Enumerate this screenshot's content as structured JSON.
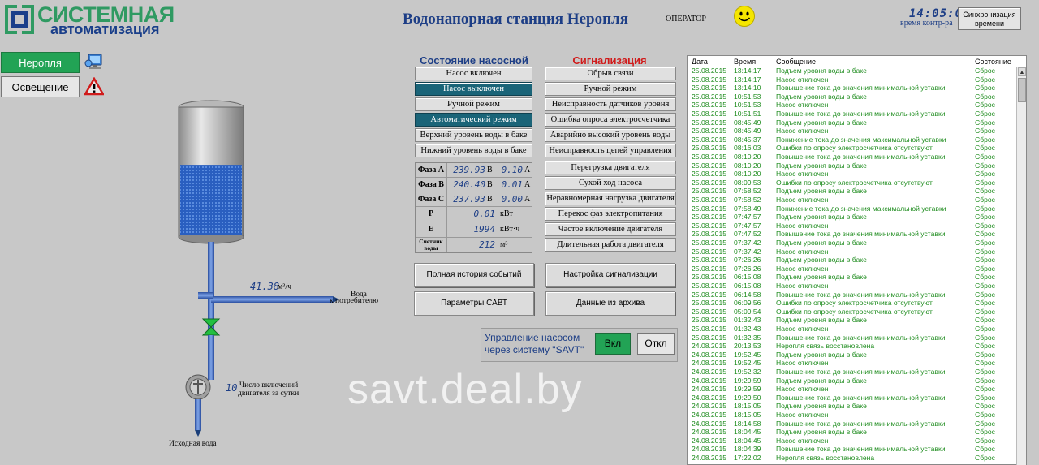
{
  "header": {
    "logo_line1": "СИСТЕМНАЯ",
    "logo_line2": "автоматизация",
    "title": "Водонапорная станция Неропля",
    "operator": "ОПЕРАТОР",
    "clock": "14:05:03",
    "clock_label": "время контр-ра",
    "sync_button": [
      "Синхронизация",
      "времени"
    ]
  },
  "nav": {
    "items": [
      {
        "label": "Неропля",
        "active": true
      },
      {
        "label": "Освещение",
        "active": false
      }
    ]
  },
  "diagram": {
    "flow_value": "41.38",
    "flow_unit": "м³/ч",
    "water_out": [
      "Вода",
      "к потребителю"
    ],
    "starts_value": "10",
    "starts_label": [
      "Число включений",
      "двигателя за сутки"
    ],
    "source_label": "Исходная вода",
    "tank_level": 0.55
  },
  "state": {
    "title": "Состояние насосной",
    "buttons": [
      {
        "label": "Насос включен",
        "on": false
      },
      {
        "label": "Насос выключен",
        "on": true
      },
      {
        "label": "Ручной режим",
        "on": false
      },
      {
        "label": "Автоматический режим",
        "on": true
      },
      {
        "label": "Верхний уровень воды в баке",
        "on": false
      },
      {
        "label": "Нижний уровень воды в баке",
        "on": false
      }
    ],
    "phases": [
      {
        "label": "Фаза А",
        "voltage": "239.93",
        "v_unit": "В",
        "current": "0.10",
        "i_unit": "А"
      },
      {
        "label": "Фаза В",
        "voltage": "240.40",
        "v_unit": "В",
        "current": "0.01",
        "i_unit": "А"
      },
      {
        "label": "Фаза С",
        "voltage": "237.93",
        "v_unit": "В",
        "current": "0.00",
        "i_unit": "А"
      }
    ],
    "power": {
      "label": "P",
      "value": "0.01",
      "unit": "кВт"
    },
    "energy": {
      "label": "E",
      "value": "1994",
      "unit": "кВт·ч"
    },
    "meter": {
      "label": [
        "Счетчик",
        "воды"
      ],
      "value": "212",
      "unit": "м³"
    }
  },
  "alarms": {
    "title": "Сигнализация",
    "buttons": [
      "Обрыв связи",
      "Ручной режим",
      "Неисправность датчиков уровня",
      "Ошибка опроса электросчетчика",
      "Аварийно высокий уровень воды",
      "Неисправность цепей управления",
      "Перегрузка двигателя",
      "Сухой ход насоса",
      "Неравномерная нагрузка двигателя",
      "Перекос фаз электропитания",
      "Частое включение двигателя",
      "Длительная работа двигателя"
    ]
  },
  "actions": {
    "history": "Полная история событий",
    "alarm_settings": "Настройка сигнализации",
    "savt_params": "Параметры САВТ",
    "archive": "Данные из архива"
  },
  "control": {
    "label": [
      "Управление насосом",
      "через систему \"SAVT\""
    ],
    "on": "Вкл",
    "off": "Откл"
  },
  "log": {
    "headers": [
      "Дата",
      "Время",
      "Сообщение",
      "Состояние"
    ],
    "rows": [
      [
        "25.08.2015",
        "13:14:17",
        "Подъем уровня воды в баке",
        "Сброс"
      ],
      [
        "25.08.2015",
        "13:14:17",
        "Насос отключен",
        "Сброс"
      ],
      [
        "25.08.2015",
        "13:14:10",
        "Повышение тока до значения минимальной уставки",
        "Сброс"
      ],
      [
        "25.08.2015",
        "10:51:53",
        "Подъем уровня воды в баке",
        "Сброс"
      ],
      [
        "25.08.2015",
        "10:51:53",
        "Насос отключен",
        "Сброс"
      ],
      [
        "25.08.2015",
        "10:51:51",
        "Повышение тока до значения минимальной уставки",
        "Сброс"
      ],
      [
        "25.08.2015",
        "08:45:49",
        "Подъем уровня воды в баке",
        "Сброс"
      ],
      [
        "25.08.2015",
        "08:45:49",
        "Насос отключен",
        "Сброс"
      ],
      [
        "25.08.2015",
        "08:45:37",
        "Понижение тока до значения максимальной уставки",
        "Сброс"
      ],
      [
        "25.08.2015",
        "08:16:03",
        "Ошибки по опросу электросчетчика отсутствуют",
        "Сброс"
      ],
      [
        "25.08.2015",
        "08:10:20",
        "Повышение тока до значения минимальной уставки",
        "Сброс"
      ],
      [
        "25.08.2015",
        "08:10:20",
        "Подъем уровня воды в баке",
        "Сброс"
      ],
      [
        "25.08.2015",
        "08:10:20",
        "Насос отключен",
        "Сброс"
      ],
      [
        "25.08.2015",
        "08:09:53",
        "Ошибки по опросу электросчетчика отсутствуют",
        "Сброс"
      ],
      [
        "25.08.2015",
        "07:58:52",
        "Подъем уровня воды в баке",
        "Сброс"
      ],
      [
        "25.08.2015",
        "07:58:52",
        "Насос отключен",
        "Сброс"
      ],
      [
        "25.08.2015",
        "07:58:49",
        "Понижение тока до значения максимальной уставки",
        "Сброс"
      ],
      [
        "25.08.2015",
        "07:47:57",
        "Подъем уровня воды в баке",
        "Сброс"
      ],
      [
        "25.08.2015",
        "07:47:57",
        "Насос отключен",
        "Сброс"
      ],
      [
        "25.08.2015",
        "07:47:52",
        "Повышение тока до значения минимальной уставки",
        "Сброс"
      ],
      [
        "25.08.2015",
        "07:37:42",
        "Подъем уровня воды в баке",
        "Сброс"
      ],
      [
        "25.08.2015",
        "07:37:42",
        "Насос отключен",
        "Сброс"
      ],
      [
        "25.08.2015",
        "07:26:26",
        "Подъем уровня воды в баке",
        "Сброс"
      ],
      [
        "25.08.2015",
        "07:26:26",
        "Насос отключен",
        "Сброс"
      ],
      [
        "25.08.2015",
        "06:15:08",
        "Подъем уровня воды в баке",
        "Сброс"
      ],
      [
        "25.08.2015",
        "06:15:08",
        "Насос отключен",
        "Сброс"
      ],
      [
        "25.08.2015",
        "06:14:58",
        "Повышение тока до значения минимальной уставки",
        "Сброс"
      ],
      [
        "25.08.2015",
        "06:09:56",
        "Ошибки по опросу электросчетчика отсутствуют",
        "Сброс"
      ],
      [
        "25.08.2015",
        "05:09:54",
        "Ошибки по опросу электросчетчика отсутствуют",
        "Сброс"
      ],
      [
        "25.08.2015",
        "01:32:43",
        "Подъем уровня воды в баке",
        "Сброс"
      ],
      [
        "25.08.2015",
        "01:32:43",
        "Насос отключен",
        "Сброс"
      ],
      [
        "25.08.2015",
        "01:32:35",
        "Повышение тока до значения минимальной уставки",
        "Сброс"
      ],
      [
        "24.08.2015",
        "20:13:53",
        "Неропля связь восстановлена",
        "Сброс"
      ],
      [
        "24.08.2015",
        "19:52:45",
        "Подъем уровня воды в баке",
        "Сброс"
      ],
      [
        "24.08.2015",
        "19:52:45",
        "Насос отключен",
        "Сброс"
      ],
      [
        "24.08.2015",
        "19:52:32",
        "Повышение тока до значения минимальной уставки",
        "Сброс"
      ],
      [
        "24.08.2015",
        "19:29:59",
        "Подъем уровня воды в баке",
        "Сброс"
      ],
      [
        "24.08.2015",
        "19:29:59",
        "Насос отключен",
        "Сброс"
      ],
      [
        "24.08.2015",
        "19:29:50",
        "Повышение тока до значения минимальной уставки",
        "Сброс"
      ],
      [
        "24.08.2015",
        "18:15:05",
        "Подъем уровня воды в баке",
        "Сброс"
      ],
      [
        "24.08.2015",
        "18:15:05",
        "Насос отключен",
        "Сброс"
      ],
      [
        "24.08.2015",
        "18:14:58",
        "Повышение тока до значения минимальной уставки",
        "Сброс"
      ],
      [
        "24.08.2015",
        "18:04:45",
        "Подъем уровня воды в баке",
        "Сброс"
      ],
      [
        "24.08.2015",
        "18:04:45",
        "Насос отключен",
        "Сброс"
      ],
      [
        "24.08.2015",
        "18:04:39",
        "Повышение тока до значения минимальной уставки",
        "Сброс"
      ],
      [
        "24.08.2015",
        "17:22:02",
        "Неропля связь восстановлена",
        "Сброс"
      ]
    ]
  },
  "watermark": "savt.deal.by",
  "colors": {
    "background": "#c8c8c8",
    "accent_green": "#22a355",
    "state_on": "#1a6478",
    "title_blue": "#1d3e86",
    "alarm_red": "#d01b1b",
    "log_text": "#1e8c1e",
    "water": "#2a5fc0"
  }
}
